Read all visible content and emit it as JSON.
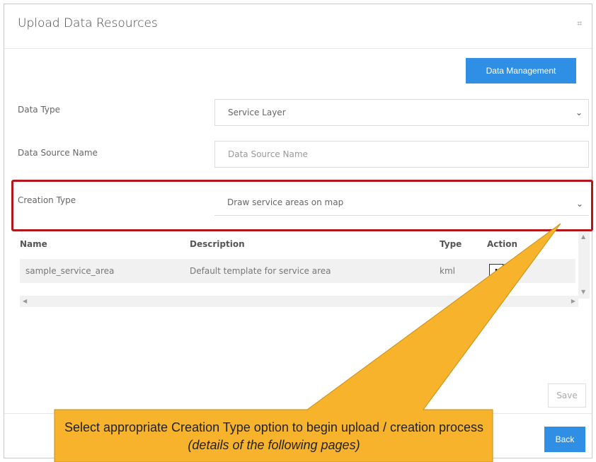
{
  "dialog": {
    "title": "Upload Data Resources",
    "collapse_icon_glyph": "⌗"
  },
  "toolbar": {
    "data_management_label": "Data Management"
  },
  "form": {
    "data_type_label": "Data Type",
    "data_type_value": "Service Layer",
    "data_source_name_label": "Data Source Name",
    "data_source_name_placeholder": "Data Source Name",
    "creation_type_label": "Creation Type",
    "creation_type_value": "Draw service areas on map"
  },
  "table": {
    "headers": [
      "Name",
      "Description",
      "Type",
      "Action"
    ],
    "rows": [
      {
        "name": "sample_service_area",
        "description": "Default template for service area",
        "type": "kml"
      }
    ]
  },
  "actions": {
    "save_label": "Save",
    "back_label": "Back"
  },
  "callout": {
    "text": "Select appropriate Creation Type option to begin upload / creation process ",
    "italic_text": "(details of the following pages)"
  },
  "colors": {
    "primary": "#2f8fe4",
    "highlight": "#b3171c",
    "callout_fill": "#f7b32b"
  }
}
